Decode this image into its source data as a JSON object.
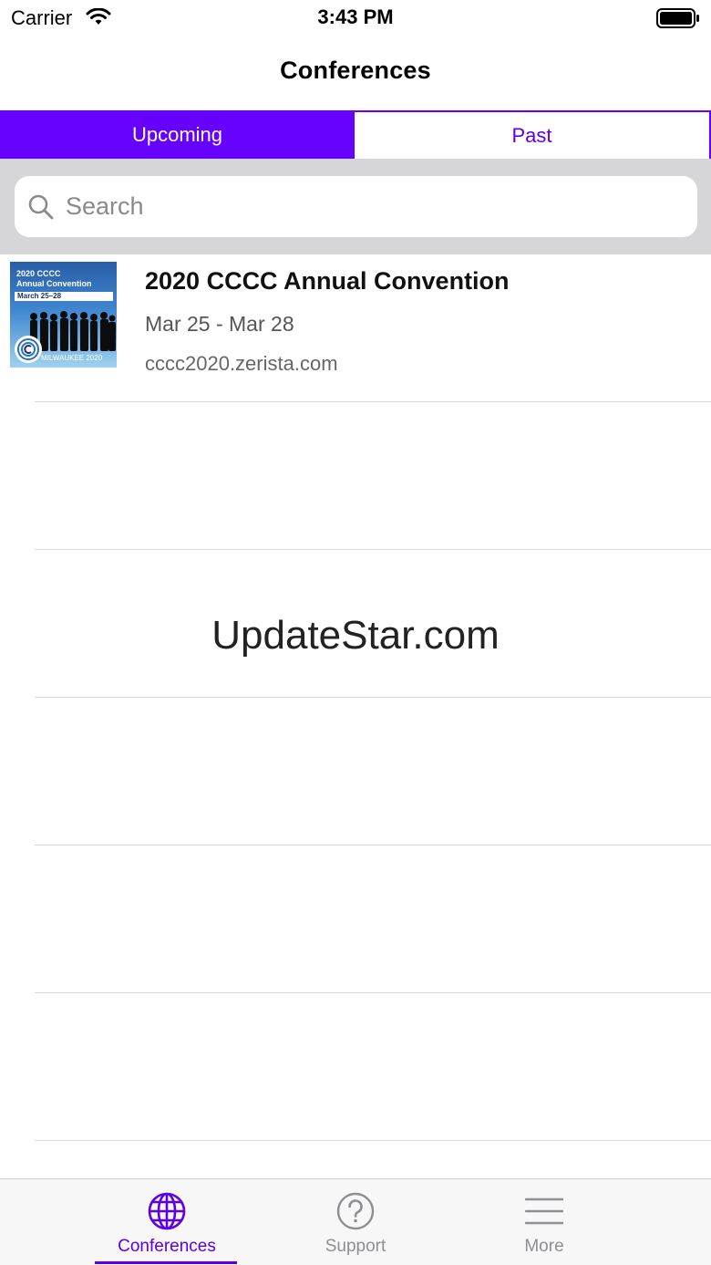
{
  "status_bar": {
    "carrier": "Carrier",
    "time": "3:43 PM"
  },
  "nav": {
    "title": "Conferences"
  },
  "segments": [
    {
      "label": "Upcoming",
      "selected": true
    },
    {
      "label": "Past",
      "selected": false
    }
  ],
  "search": {
    "placeholder": "Search",
    "value": ""
  },
  "conferences": [
    {
      "title": "2020 CCCC Annual Convention",
      "dates": "Mar 25 - Mar 28",
      "url": "cccc2020.zerista.com",
      "thumbnail": {
        "line1": "2020 CCCC",
        "line2": "Annual Convention",
        "banner": "March 25–28",
        "footer": "MILWAUKEE 2020"
      }
    }
  ],
  "watermark": "UpdateStar.com",
  "tab_bar": {
    "items": [
      {
        "label": "Conferences",
        "icon": "globe-icon",
        "selected": true
      },
      {
        "label": "Support",
        "icon": "question-circle-icon",
        "selected": false
      },
      {
        "label": "More",
        "icon": "menu-lines-icon",
        "selected": false
      }
    ]
  },
  "colors": {
    "accent": "#6600ff",
    "accent_text": "#5e00e6",
    "search_area_bg": "#d6d6d8",
    "tab_inactive": "#8e8e93"
  }
}
